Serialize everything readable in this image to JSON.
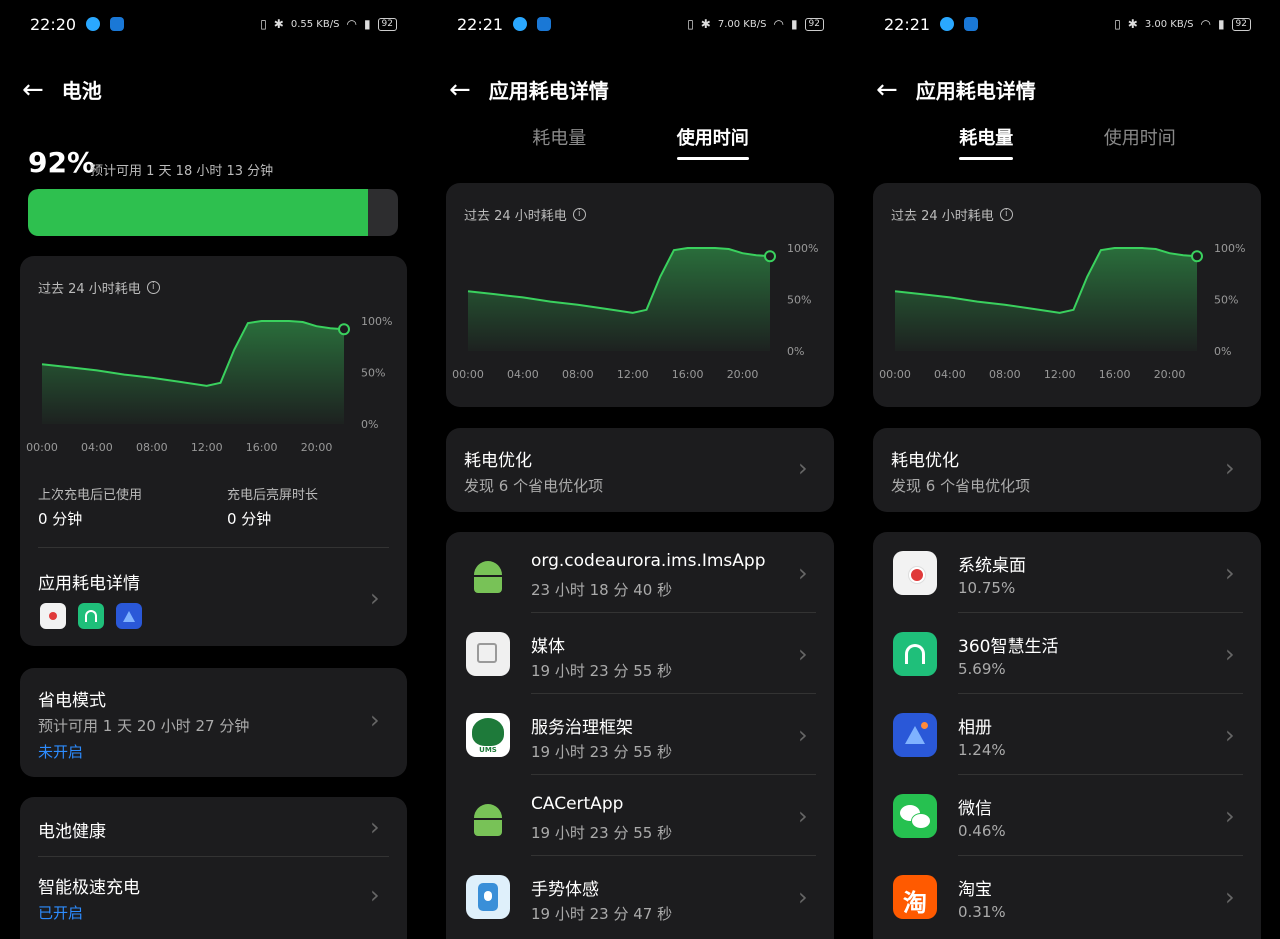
{
  "screens": [
    {
      "status": {
        "time": "22:20",
        "net_speed": "0.55 KB/S",
        "battery": "92"
      },
      "header": {
        "title": "电池"
      },
      "battery": {
        "percent_text": "92%",
        "estimate": "预计可用 1 天 18 小时 13 分钟",
        "level": 0.92
      },
      "chart_card": {
        "title": "过去 24 小时耗电"
      },
      "stats": {
        "last_charge_label": "上次充电后已使用",
        "last_charge_value": "0 分钟",
        "screen_on_label": "充电后亮屏时长",
        "screen_on_value": "0 分钟"
      },
      "app_usage": {
        "title": "应用耗电详情",
        "icons": [
          "system-desktop-icon",
          "360-home-icon",
          "album-icon"
        ]
      },
      "power_saving": {
        "title": "省电模式",
        "estimate": "预计可用 1 天 20 小时 27 分钟",
        "status": "未开启"
      },
      "battery_health": {
        "title": "电池健康"
      },
      "fast_charge": {
        "title": "智能极速充电",
        "status": "已开启"
      }
    },
    {
      "status": {
        "time": "22:21",
        "net_speed": "7.00 KB/S",
        "battery": "92"
      },
      "header": {
        "title": "应用耗电详情"
      },
      "tabs": [
        "耗电量",
        "使用时间"
      ],
      "active_tab": 1,
      "chart_card": {
        "title": "过去 24 小时耗电"
      },
      "optimize": {
        "title": "耗电优化",
        "subtitle": "发现 6 个省电优化项"
      },
      "apps": [
        {
          "name": "org.codeaurora.ims.ImsApp",
          "value": "23 小时 18 分 40 秒",
          "icon": "android-icon"
        },
        {
          "name": "媒体",
          "value": "19 小时 23 分 55 秒",
          "icon": "media-icon"
        },
        {
          "name": "服务治理框架",
          "value": "19 小时 23 分 55 秒",
          "icon": "ums-icon"
        },
        {
          "name": "CACertApp",
          "value": "19 小时 23 分 55 秒",
          "icon": "android-icon"
        },
        {
          "name": "手势体感",
          "value": "19 小时 23 分 47 秒",
          "icon": "gesture-icon"
        }
      ]
    },
    {
      "status": {
        "time": "22:21",
        "net_speed": "3.00 KB/S",
        "battery": "92"
      },
      "header": {
        "title": "应用耗电详情"
      },
      "tabs": [
        "耗电量",
        "使用时间"
      ],
      "active_tab": 0,
      "chart_card": {
        "title": "过去 24 小时耗电"
      },
      "optimize": {
        "title": "耗电优化",
        "subtitle": "发现 6 个省电优化项"
      },
      "apps": [
        {
          "name": "系统桌面",
          "value": "10.75%",
          "icon": "system-desktop-icon"
        },
        {
          "name": "360智慧生活",
          "value": "5.69%",
          "icon": "360-home-icon"
        },
        {
          "name": "相册",
          "value": "1.24%",
          "icon": "album-icon"
        },
        {
          "name": "微信",
          "value": "0.46%",
          "icon": "wechat-icon"
        },
        {
          "name": "淘宝",
          "value": "0.31%",
          "icon": "taobao-icon"
        }
      ]
    }
  ],
  "chart_data": {
    "type": "area",
    "x": [
      "00:00",
      "02:00",
      "04:00",
      "06:00",
      "08:00",
      "10:00",
      "12:00",
      "13:00",
      "14:00",
      "15:00",
      "16:00",
      "17:00",
      "18:00",
      "19:00",
      "20:00",
      "21:00",
      "22:00"
    ],
    "y": [
      58,
      55,
      52,
      48,
      45,
      41,
      37,
      40,
      72,
      98,
      100,
      100,
      100,
      99,
      95,
      93,
      92
    ],
    "x_ticks": [
      "00:00",
      "04:00",
      "08:00",
      "12:00",
      "16:00",
      "20:00"
    ],
    "y_ticks": [
      "100%",
      "50%",
      "0%"
    ],
    "ylim": [
      0,
      100
    ],
    "color": "#3ad15e"
  },
  "colors": {
    "accent_green": "#2ec04f",
    "link_blue": "#2d8cff",
    "card": "#1c1c1e"
  }
}
